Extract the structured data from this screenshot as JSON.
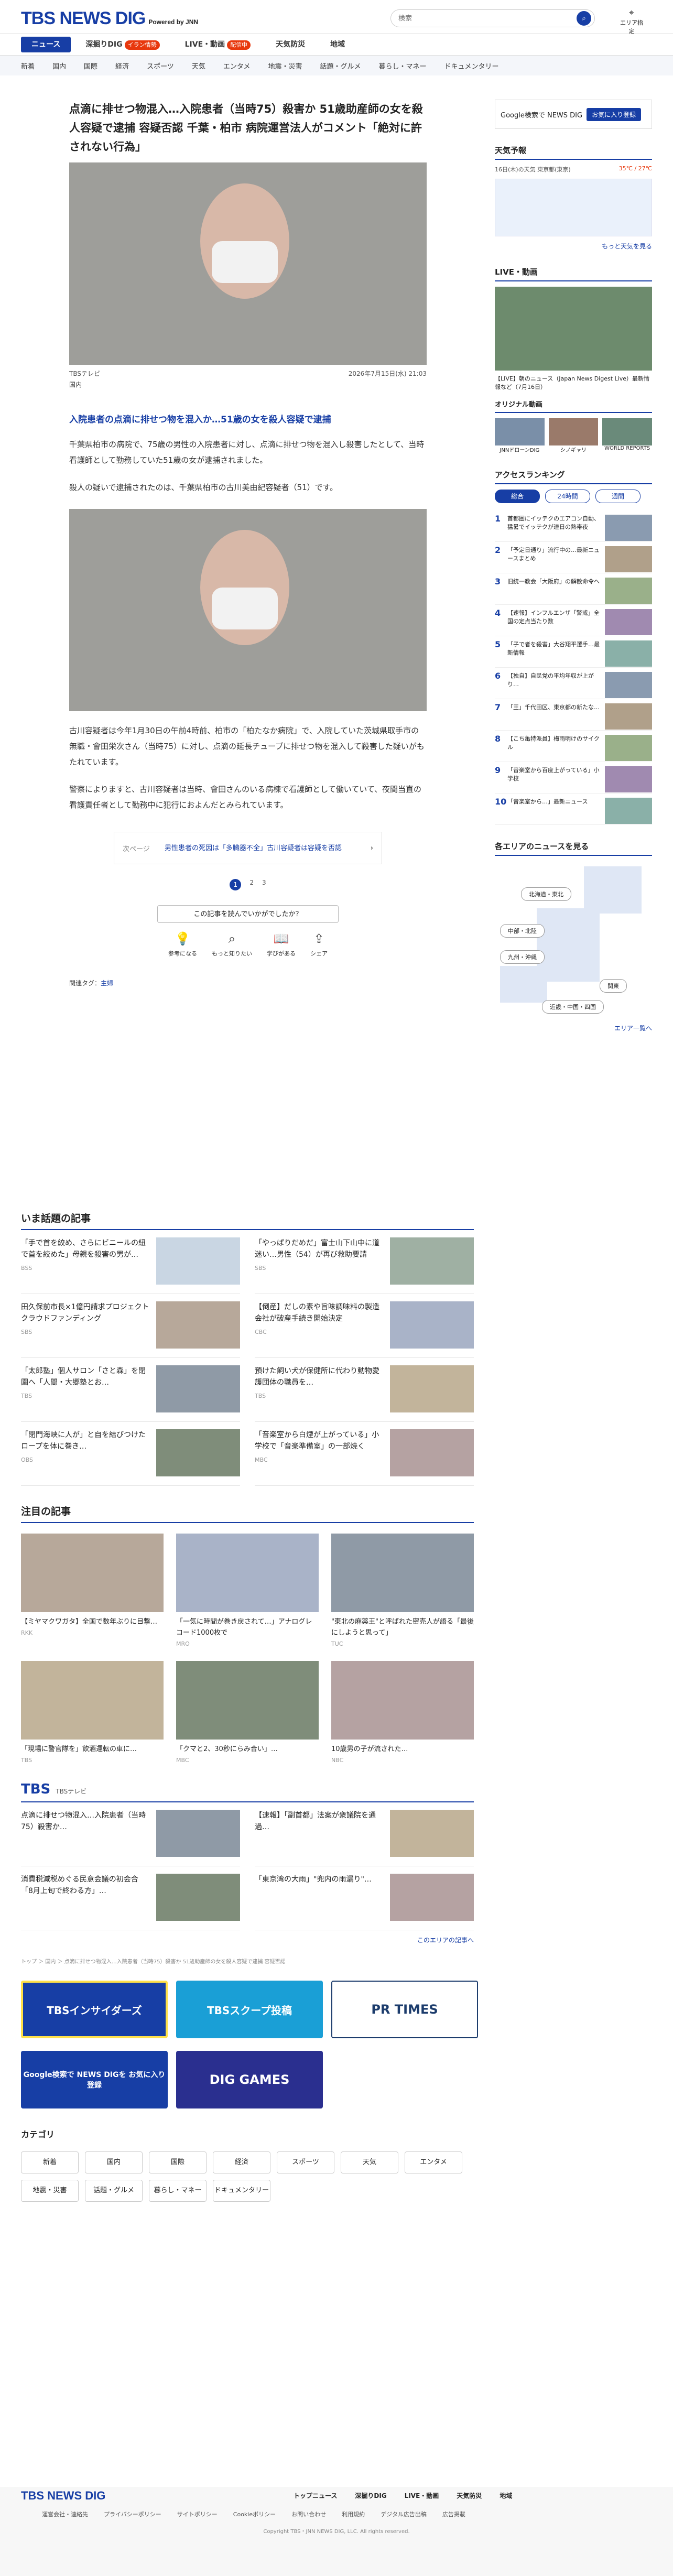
{
  "header": {
    "logo": "TBS NEWS DIG",
    "logo_sub": "Powered by JNN",
    "search_placeholder": "検索",
    "area_label": "エリア指定"
  },
  "nav_primary": [
    "ニュース",
    "深掘りDIG",
    "LIVE・動画",
    "天気防災",
    "地域"
  ],
  "nav_badges": {
    "dig": "イラン情勢",
    "live": "配信中"
  },
  "nav_secondary": [
    "新着",
    "国内",
    "国際",
    "経済",
    "スポーツ",
    "天気",
    "エンタメ",
    "地震・災害",
    "話題・グルメ",
    "暮らし・マネー",
    "ドキュメンタリー"
  ],
  "article": {
    "title": "点滴に排せつ物混入…入院患者（当時75）殺害か 51歳助産師の女を殺人容疑で逮捕 容疑否認 千葉・柏市 病院運営法人がコメント「絶対に許されない行為」",
    "source": "TBSテレビ",
    "date": "2026年7月15日(水) 21:03",
    "category": "国内",
    "lead": "入院患者の点滴に排せつ物を混入か…51歳の女を殺人容疑で逮捕",
    "paragraphs": [
      "千葉県柏市の病院で、75歳の男性の入院患者に対し、点滴に排せつ物を混入し殺害したとして、当時看護師として勤務していた51歳の女が逮捕されました。",
      "殺人の疑いで逮捕されたのは、千葉県柏市の古川美由紀容疑者（51）です。",
      "古川容疑者は今年1月30日の午前4時前、柏市の「柏たなか病院」で、入院していた茨城県取手市の無職・會田栄次さん（当時75）に対し、点滴の延長チューブに排せつ物を混入して殺害した疑いがもたれています。",
      "警察によりますと、古川容疑者は当時、會田さんのいる病棟で看護師として働いていて、夜間当直の看護責任者として勤務中に犯行におよんだとみられています。"
    ],
    "related_label": "次ページ",
    "related_text": "男性患者の死因は「多臓器不全」古川容疑者は容疑を否認",
    "pages": [
      "1",
      "2",
      "3"
    ],
    "question": "この記事を読んでいかがでしたか？",
    "reactions": [
      "参考になる",
      "もっと知りたい",
      "学びがある",
      "シェア"
    ],
    "tags_label": "関連タグ：",
    "tag": "主婦"
  },
  "sidebar": {
    "google_ad": "Google検索で NEWS DIG",
    "google_btn": "お気に入り登録",
    "weather_title": "天気予報",
    "weather_text": "16日(木)の天気 東京都(東京)",
    "weather_temp": "35℃ / 27℃",
    "more": "もっと天気を見る",
    "live_title": "LIVE・動画",
    "live_item": "【LIVE】朝のニュース（Japan News Digest Live）最新情報など（7月16日）",
    "original_title": "オリジナル動画",
    "originals": [
      "JNNドローンDIG",
      "シノギャリ",
      "WORLD REPORTS"
    ],
    "ranking_title": "アクセスランキング",
    "ranking_tabs": [
      "総合",
      "24時間",
      "週間"
    ],
    "ranking": [
      "首都圏にイッテクのエアコン自動、猛暑でイッテクが連日の熱帯夜",
      "「予定日通り」流行中の…最新ニュースまとめ",
      "旧統一教会「大阪府」の解散命令へ",
      "【速報】インフルエンザ「警戒」全国の定点当たり数",
      "「子で者を殺害」大谷翔平選手…最新情報",
      "【独自】自民党の平均年収が上がり…",
      "「王」千代田区、東京都の新たな…",
      "【こち亀特派員】梅雨明けのサイクル",
      "「音楽室から百度上がっている」小学校",
      "「音楽室から…」最新ニュース"
    ],
    "region_title": "各エリアのニュースを見る",
    "regions": [
      "北海道・東北",
      "中部・北陸",
      "九州・沖縄",
      "関東",
      "近畿・中国・四国"
    ],
    "region_more": "エリア一覧へ"
  },
  "trending": {
    "title": "いま話題の記事",
    "items": [
      {
        "text": "「手で首を絞め、さらにビニールの紐で首を絞めた」母親を殺害の男が…",
        "src": "BSS"
      },
      {
        "text": "「やっぱりだめだ」富士山下山中に道迷い…男性（54）が再び救助要請",
        "src": "SBS"
      },
      {
        "text": "田久保前市長×1億円請求プロジェクト クラウドファンディング",
        "src": "SBS"
      },
      {
        "text": "【倒産】だしの素や旨味調味料の製造会社が破産手続き開始決定",
        "src": "CBC"
      },
      {
        "text": "「太郎塾」個人サロン「さと森」を閉園へ「人間・大郷塾とお…",
        "src": "TBS"
      },
      {
        "text": "預けた飼い犬が保健所に代わり動物愛護団体の職員を…",
        "src": "TBS"
      },
      {
        "text": "「閉門海峡に人が」と自を結びつけたロープを体に巻き…",
        "src": "OBS"
      },
      {
        "text": "「音楽室から白煙が上がっている」小学校で「音楽準備室」の一部焼く",
        "src": "MBC"
      }
    ]
  },
  "featured": {
    "title": "注目の記事",
    "items": [
      {
        "text": "【ミヤマクワガタ】全国で数年ぶりに目撃…",
        "src": "RKK"
      },
      {
        "text": "「一気に時間が巻き戻されて…」アナログレコード1000枚で",
        "src": "MRO"
      },
      {
        "text": "\"東北の麻薬王\"と呼ばれた密売人が語る「最後にしようと思って」",
        "src": "TUC"
      },
      {
        "text": "「現場に警官隊を」飲酒運転の車に…",
        "src": "TBS"
      },
      {
        "text": "「クマと2、30秒にらみ合い」…",
        "src": "MBC"
      },
      {
        "text": "10歳男の子が流された…",
        "src": "NBC"
      }
    ]
  },
  "local": {
    "logo": "TBS",
    "sub": "TBSテレビ",
    "items": [
      {
        "text": "点滴に排せつ物混入…入院患者（当時75）殺害か…"
      },
      {
        "text": "【速報】「副首都」法案が衆議院を通過…"
      },
      {
        "text": "消費税減税めぐる民意会議の初会合「8月上旬で終わる方」…"
      },
      {
        "text": "「東京湾の大雨」\"兜内の雨漏り\"…"
      }
    ],
    "more": "このエリアの記事へ"
  },
  "breadcrumb": "トップ ＞ 国内 ＞ 点滴に排せつ物混入…入院患者（当時75）殺害か 51歳助産師の女を殺人容疑で逮捕 容疑否認",
  "banners": [
    "TBSインサイダーズ",
    "TBSスクープ投稿",
    "PR TIMES",
    "Google検索で NEWS DIGを お気に入り登録",
    "DIG GAMES"
  ],
  "category_title": "カテゴリ",
  "categories": [
    "新着",
    "国内",
    "国際",
    "経済",
    "スポーツ",
    "天気",
    "エンタメ",
    "地震・災害",
    "話題・グルメ",
    "暮らし・マネー",
    "ドキュメンタリー"
  ],
  "footer": {
    "links1": [
      "トップニュース",
      "深掘りDIG",
      "LIVE・動画",
      "天気防災",
      "地域"
    ],
    "links2": [
      "運営会社・連絡先",
      "プライバシーポリシー",
      "サイトポリシー",
      "Cookieポリシー",
      "お問い合わせ",
      "利用規約",
      "デジタル広告出稿",
      "広告掲載"
    ],
    "copyright": "Copyright TBS・JNN NEWS DIG, LLC. All rights reserved."
  }
}
